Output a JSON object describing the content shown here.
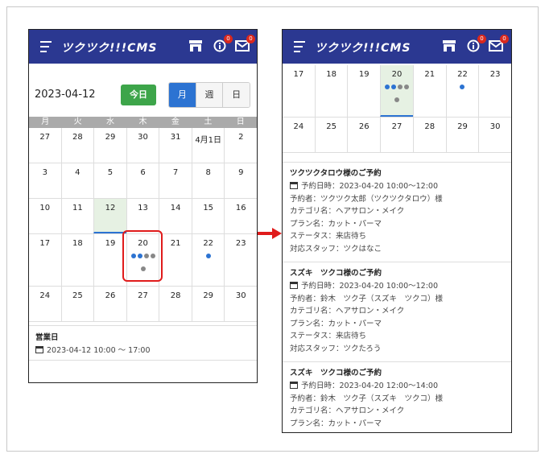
{
  "app": {
    "logo": "ツクツク!!!CMS",
    "badge_info": "0",
    "badge_mail": "0"
  },
  "left": {
    "date": "2023-04-12",
    "today_button": "今日",
    "views": [
      "月",
      "週",
      "日"
    ],
    "weekdays": [
      "月",
      "火",
      "水",
      "木",
      "金",
      "土",
      "日"
    ],
    "weeks": [
      [
        "27",
        "28",
        "29",
        "30",
        "31",
        "4月1日",
        "2"
      ],
      [
        "3",
        "4",
        "5",
        "6",
        "7",
        "8",
        "9"
      ],
      [
        "10",
        "11",
        "12",
        "13",
        "14",
        "15",
        "16"
      ],
      [
        "17",
        "18",
        "19",
        "20",
        "21",
        "22",
        "23"
      ],
      [
        "24",
        "25",
        "26",
        "27",
        "28",
        "29",
        "30"
      ]
    ],
    "business": {
      "title": "営業日",
      "time": "2023-04-12 10:00 〜 17:00"
    }
  },
  "right": {
    "weeks": [
      [
        "17",
        "18",
        "19",
        "20",
        "21",
        "22",
        "23"
      ],
      [
        "24",
        "25",
        "26",
        "27",
        "28",
        "29",
        "30"
      ]
    ],
    "reservations": [
      {
        "title": "ツクツクタロウ様のご予約",
        "time": "予約日時：2023-04-20 10:00〜12:00",
        "lines": [
          "予約者：ツクツク太郎（ツクツクタロウ）様",
          "カテゴリ名：ヘアサロン・メイク",
          "プラン名：カット・パーマ",
          "ステータス：来店待ち",
          "対応スタッフ：ツクはなこ"
        ]
      },
      {
        "title": "スズキ　ツクコ様のご予約",
        "time": "予約日時：2023-04-20 10:00〜12:00",
        "lines": [
          "予約者：鈴木　ツク子（スズキ　ツクコ）様",
          "カテゴリ名：ヘアサロン・メイク",
          "プラン名：カット・パーマ",
          "ステータス：来店待ち",
          "対応スタッフ：ツクたろう"
        ]
      },
      {
        "title": "スズキ　ツクコ様のご予約",
        "time": "予約日時：2023-04-20 12:00〜14:00",
        "lines": [
          "予約者：鈴木　ツク子（スズキ　ツクコ）様",
          "カテゴリ名：ヘアサロン・メイク",
          "プラン名：カット・パーマ"
        ]
      }
    ]
  },
  "colors": {
    "header": "#2b3891",
    "accent": "#2c73d2",
    "today": "#3da54a",
    "highlight": "#e01b1b"
  }
}
